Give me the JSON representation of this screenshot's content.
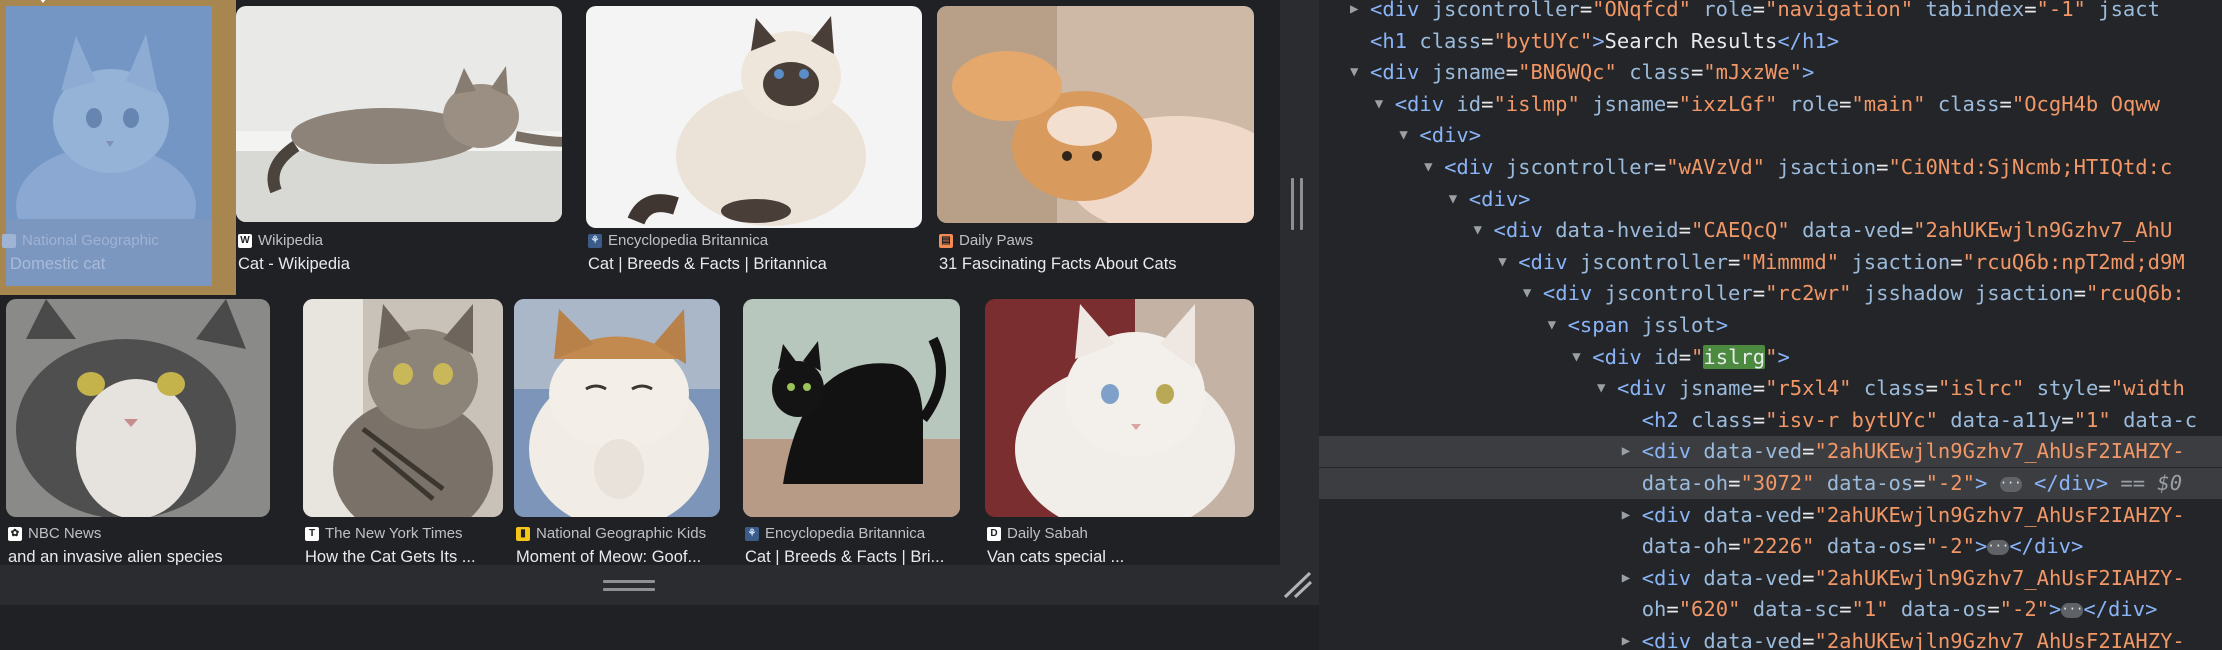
{
  "results": {
    "row1": [
      {
        "source": "National Geographic",
        "title": "Domestic cat",
        "favicon": "natgeo-icon",
        "fav_color": "#f5c518",
        "selected": true
      },
      {
        "source": "Wikipedia",
        "title": "Cat - Wikipedia",
        "favicon": "wikipedia-icon",
        "fav_color": "#ffffff"
      },
      {
        "source": "Encyclopedia Britannica",
        "title": "Cat | Breeds & Facts | Britannica",
        "favicon": "britannica-icon",
        "fav_color": "#8ab4f8"
      },
      {
        "source": "Daily Paws",
        "title": "31 Fascinating Facts About Cats",
        "favicon": "dailypaws-icon",
        "fav_color": "#f28b54"
      }
    ],
    "row2": [
      {
        "source": "NBC News",
        "title": "and an invasive alien species",
        "favicon": "nbc-icon",
        "fav_color": "#ffffff"
      },
      {
        "source": "The New York Times",
        "title": "How the Cat Gets Its ...",
        "favicon": "nyt-icon",
        "fav_color": "#ffffff"
      },
      {
        "source": "National Geographic Kids",
        "title": "Moment of Meow: Goof...",
        "favicon": "natgeokids-icon",
        "fav_color": "#f5c518"
      },
      {
        "source": "Encyclopedia Britannica",
        "title": "Cat | Breeds & Facts | Bri...",
        "favicon": "britannica-icon",
        "fav_color": "#8ab4f8"
      },
      {
        "source": "Daily Sabah",
        "title": "Van cats special ...",
        "favicon": "dailysabah-icon",
        "fav_color": "#ffffff"
      }
    ]
  },
  "devtools": {
    "lines": [
      {
        "indent": 0,
        "arrow": "right",
        "html": "<span class='tag'>&lt;div</span> <span class='an'>jscontroller</span><span class='txt'>=</span><span class='aval'>\"ONqfcd\"</span> <span class='an'>role</span><span class='txt'>=</span><span class='aval'>\"navigation\"</span> <span class='an'>tabindex</span><span class='txt'>=</span><span class='aval'>\"-1\"</span> <span class='an'>jsact</span>"
      },
      {
        "indent": 0,
        "arrow": "",
        "html": "<span class='tag'>&lt;h1</span> <span class='an'>class</span><span class='txt'>=</span><span class='aval'>\"bytUYc\"</span><span class='tag'>&gt;</span><span class='txt'>Search Results</span><span class='tag'>&lt;/h1&gt;</span>"
      },
      {
        "indent": 0,
        "arrow": "down",
        "html": "<span class='tag'>&lt;div</span> <span class='an'>jsname</span><span class='txt'>=</span><span class='aval'>\"BN6WQc\"</span> <span class='an'>class</span><span class='txt'>=</span><span class='aval'>\"mJxzWe\"</span><span class='tag'>&gt;</span>"
      },
      {
        "indent": 1,
        "arrow": "down",
        "html": "<span class='tag'>&lt;div</span> <span class='an'>id</span><span class='txt'>=</span><span class='aval'>\"islmp\"</span> <span class='an'>jsname</span><span class='txt'>=</span><span class='aval'>\"ixzLGf\"</span> <span class='an'>role</span><span class='txt'>=</span><span class='aval'>\"main\"</span> <span class='an'>class</span><span class='txt'>=</span><span class='aval'>\"OcgH4b Oqww</span>"
      },
      {
        "indent": 2,
        "arrow": "down",
        "html": "<span class='tag'>&lt;div&gt;</span>"
      },
      {
        "indent": 3,
        "arrow": "down",
        "html": "<span class='tag'>&lt;div</span> <span class='an'>jscontroller</span><span class='txt'>=</span><span class='aval'>\"wAVzVd\"</span> <span class='an'>jsaction</span><span class='txt'>=</span><span class='aval'>\"Ci0Ntd:SjNcmb;HTIQtd:c</span>"
      },
      {
        "indent": 4,
        "arrow": "down",
        "html": "<span class='tag'>&lt;div&gt;</span>"
      },
      {
        "indent": 5,
        "arrow": "down",
        "html": "<span class='tag'>&lt;div</span> <span class='an'>data-hveid</span><span class='txt'>=</span><span class='aval'>\"CAEQcQ\"</span> <span class='an'>data-ved</span><span class='txt'>=</span><span class='aval'>\"2ahUKEwjln9Gzhv7_AhU</span>"
      },
      {
        "indent": 6,
        "arrow": "down",
        "html": "<span class='tag'>&lt;div</span> <span class='an'>jscontroller</span><span class='txt'>=</span><span class='aval'>\"Mimmmd\"</span> <span class='an'>jsaction</span><span class='txt'>=</span><span class='aval'>\"rcuQ6b:npT2md;d9M</span>"
      },
      {
        "indent": 7,
        "arrow": "down",
        "html": "<span class='tag'>&lt;div</span> <span class='an'>jscontroller</span><span class='txt'>=</span><span class='aval'>\"rc2wr\"</span> <span class='an'>jsshadow</span> <span class='an'>jsaction</span><span class='txt'>=</span><span class='aval'>\"rcuQ6b:</span>"
      },
      {
        "indent": 8,
        "arrow": "down",
        "html": "<span class='tag'>&lt;span</span> <span class='an'>jsslot</span><span class='tag'>&gt;</span>"
      },
      {
        "indent": 9,
        "arrow": "down",
        "html": "<span class='tag'>&lt;div</span> <span class='an'>id</span><span class='txt'>=</span><span class='aval'>\"<span class='hl'>islrg</span>\"</span><span class='tag'>&gt;</span>"
      },
      {
        "indent": 10,
        "arrow": "down",
        "html": "<span class='tag'>&lt;div</span> <span class='an'>jsname</span><span class='txt'>=</span><span class='aval'>\"r5xl4\"</span> <span class='an'>class</span><span class='txt'>=</span><span class='aval'>\"islrc\"</span> <span class='an'>style</span><span class='txt'>=</span><span class='aval'>\"width</span>"
      },
      {
        "indent": 11,
        "arrow": "",
        "html": "<span class='tag'>&lt;h2</span> <span class='an'>class</span><span class='txt'>=</span><span class='aval'>\"isv-r bytUYc\"</span> <span class='an'>data-a11y</span><span class='txt'>=</span><span class='aval'>\"1\"</span> <span class='an'>data-c</span>"
      },
      {
        "indent": 11,
        "arrow": "right",
        "sel": true,
        "html": "<span class='tag'>&lt;div</span> <span class='an'>data-ved</span><span class='txt'>=</span><span class='aval'>\"2ahUKEwjln9Gzhv7_AhUsF2IAHZY-</span>"
      },
      {
        "indent": 11,
        "arrow": "",
        "sel": true,
        "html": "<span class='an'>data-oh</span><span class='txt'>=</span><span class='aval'>\"3072\"</span> <span class='an'>data-os</span><span class='txt'>=</span><span class='aval'>\"-2\"</span><span class='tag'>&gt;</span> <span class='ell'>···</span> <span class='tag'>&lt;/div&gt;</span> <span class='dollar'>== $0</span>"
      },
      {
        "indent": 11,
        "arrow": "right",
        "html": "<span class='tag'>&lt;div</span> <span class='an'>data-ved</span><span class='txt'>=</span><span class='aval'>\"2ahUKEwjln9Gzhv7_AhUsF2IAHZY-</span>"
      },
      {
        "indent": 11,
        "arrow": "",
        "html": "<span class='an'>data-oh</span><span class='txt'>=</span><span class='aval'>\"2226\"</span> <span class='an'>data-os</span><span class='txt'>=</span><span class='aval'>\"-2\"</span><span class='tag'>&gt;</span><span class='ell'>···</span><span class='tag'>&lt;/div&gt;</span>"
      },
      {
        "indent": 11,
        "arrow": "right",
        "html": "<span class='tag'>&lt;div</span> <span class='an'>data-ved</span><span class='txt'>=</span><span class='aval'>\"2ahUKEwjln9Gzhv7_AhUsF2IAHZY-</span>"
      },
      {
        "indent": 11,
        "arrow": "",
        "html": "<span class='an'>oh</span><span class='txt'>=</span><span class='aval'>\"620\"</span> <span class='an'>data-sc</span><span class='txt'>=</span><span class='aval'>\"1\"</span> <span class='an'>data-os</span><span class='txt'>=</span><span class='aval'>\"-2\"</span><span class='tag'>&gt;</span><span class='ell'>···</span><span class='tag'>&lt;/div&gt;</span>"
      },
      {
        "indent": 11,
        "arrow": "right",
        "html": "<span class='tag'>&lt;div</span> <span class='an'>data-ved</span><span class='txt'>=</span><span class='aval'>\"2ahUKEwjln9Gzhv7_AhUsF2IAHZY-</span>"
      }
    ]
  }
}
